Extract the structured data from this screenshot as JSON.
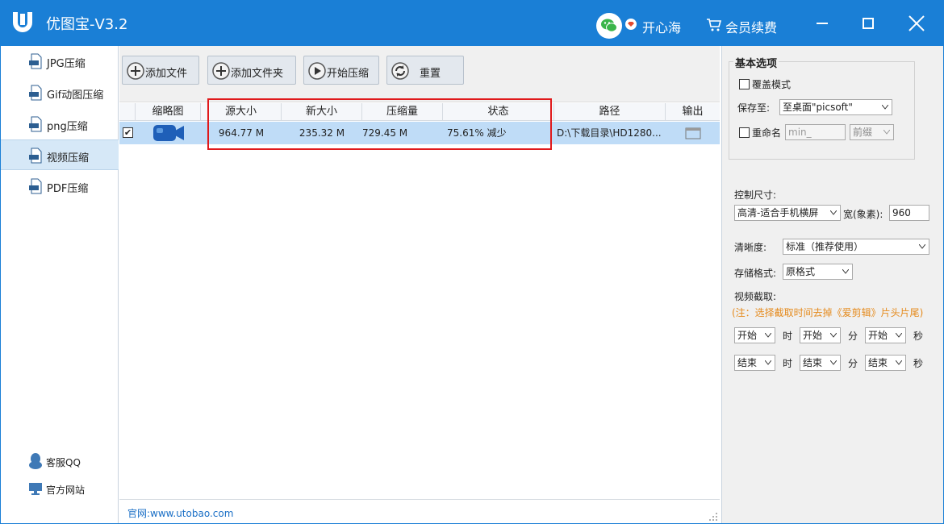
{
  "app": {
    "title": "优图宝-V3.2",
    "user": "开心海",
    "renew": "会员续费"
  },
  "sidebar": {
    "items": [
      {
        "label": "JPG压缩",
        "icon": "jpg-file-icon"
      },
      {
        "label": "Gif动图压缩",
        "icon": "gif-file-icon"
      },
      {
        "label": "png压缩",
        "icon": "png-file-icon"
      },
      {
        "label": "视频压缩",
        "icon": "video-file-icon",
        "active": true
      },
      {
        "label": "PDF压缩",
        "icon": "pdf-file-icon"
      }
    ],
    "service": "客服QQ",
    "website": "官方网站"
  },
  "toolbar": {
    "add_file": "添加文件",
    "add_folder": "添加文件夹",
    "start": "开始压缩",
    "reset": "重置"
  },
  "table": {
    "headers": [
      "缩略图",
      "源大小",
      "新大小",
      "压缩量",
      "状态",
      "路径",
      "输出"
    ],
    "rows": [
      {
        "checked": true,
        "source_size": "964.77 M",
        "new_size": "235.32 M",
        "saved": "729.45 M",
        "status": "75.61% 减少",
        "path": "D:\\下载目录\\HD1280..."
      }
    ]
  },
  "status": {
    "site": "官网:www.utobao.com"
  },
  "options": {
    "basic_title": "基本选项",
    "overwrite": "覆盖模式",
    "save_to_label": "保存至:",
    "save_to_value": "至桌面\"picsoft\"",
    "rename_label": "重命名",
    "rename_placeholder": "min_",
    "rename_pos": "前缀",
    "size_label": "控制尺寸:",
    "size_value": "高清-适合手机横屏",
    "width_label": "宽(象素):",
    "width_value": "960",
    "clarity_label": "清晰度:",
    "clarity_value": "标准（推荐使用）",
    "format_label": "存储格式:",
    "format_value": "原格式",
    "clip_label": "视频截取:",
    "clip_note": "(注：选择截取时间去掉《爱剪辑》片头片尾)",
    "start_h": "开始",
    "start_m": "开始",
    "start_s": "开始",
    "end_h": "结束",
    "end_m": "结束",
    "end_s": "结束",
    "unit_h": "时",
    "unit_m": "分",
    "unit_s": "秒"
  },
  "colors": {
    "accent": "#1a7fd6",
    "selected_row": "#bfdcf7",
    "highlight": "#e0191b",
    "note": "#e58a1c"
  }
}
